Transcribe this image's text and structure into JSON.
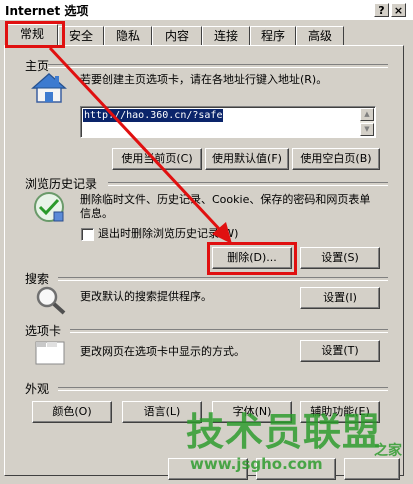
{
  "window": {
    "title": "Internet 选项",
    "help_glyph": "?",
    "close_glyph": "×"
  },
  "tabs": [
    {
      "label": "常规"
    },
    {
      "label": "安全"
    },
    {
      "label": "隐私"
    },
    {
      "label": "内容"
    },
    {
      "label": "连接"
    },
    {
      "label": "程序"
    },
    {
      "label": "高级"
    }
  ],
  "homepage": {
    "title": "主页",
    "desc": "若要创建主页选项卡，请在各地址行键入地址(R)。",
    "url": "http://hao.360.cn/?safe",
    "use_current": "使用当前页(C)",
    "use_default": "使用默认值(F)",
    "use_blank": "使用空白页(B)"
  },
  "history": {
    "title": "浏览历史记录",
    "desc": "删除临时文件、历史记录、Cookie、保存的密码和网页表单信息。",
    "exit_checkbox": "退出时删除浏览历史记录(W)",
    "delete_button": "删除(D)...",
    "settings_button": "设置(S)"
  },
  "search": {
    "title": "搜索",
    "desc": "更改默认的搜索提供程序。",
    "settings_button": "设置(I)"
  },
  "tabs_section": {
    "title": "选项卡",
    "desc": "更改网页在选项卡中显示的方式。",
    "settings_button": "设置(T)"
  },
  "appearance": {
    "title": "外观",
    "colors": "颜色(O)",
    "languages": "语言(L)",
    "fonts": "字体(N)",
    "accessibility": "辅助功能(E)"
  },
  "watermark": {
    "main": "技术员联盟",
    "suffix": "之家",
    "url": "www.jsgho.com"
  },
  "colors": {
    "highlight": "#e01010",
    "selection": "#0a246a",
    "watermark": "#2a9a2a"
  }
}
